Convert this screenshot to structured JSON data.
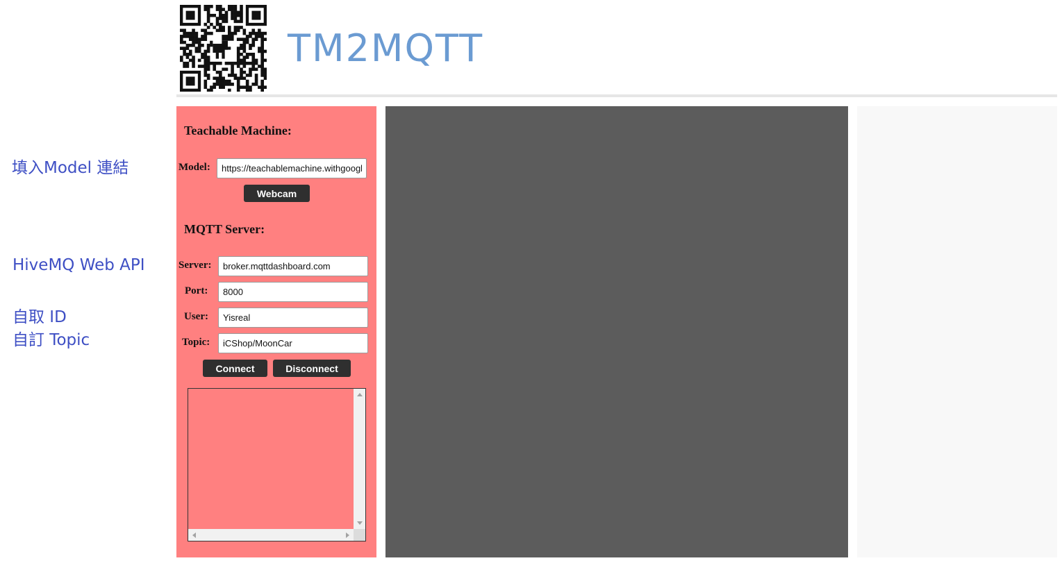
{
  "header": {
    "logo_text": "TM2MQTT",
    "qr_icon": "qr-code-with-dinosaur-icon"
  },
  "notes": {
    "model_note": "填入Model 連結",
    "api_note": "HiveMQ Web API",
    "id_note": "自取 ID",
    "topic_note": "自訂 Topic"
  },
  "teachable": {
    "title": "Teachable Machine:",
    "model_label": "Model:",
    "model_value": "https://teachablemachine.withgoogle.com/models/",
    "webcam_button": "Webcam"
  },
  "mqtt": {
    "title": "MQTT Server:",
    "server_label": "Server:",
    "server_value": "broker.mqttdashboard.com",
    "port_label": "Port:",
    "port_value": "8000",
    "user_label": "User:",
    "user_value": "Yisreal",
    "topic_label": "Topic:",
    "topic_value": "iCShop/MoonCar",
    "connect_button": "Connect",
    "disconnect_button": "Disconnect"
  },
  "colors": {
    "panel": "#ff8080",
    "webcam_area": "#5c5c5c",
    "note_text": "#3e4fc4",
    "logo_text": "#6b9bd2",
    "button": "#2f2f2f"
  }
}
